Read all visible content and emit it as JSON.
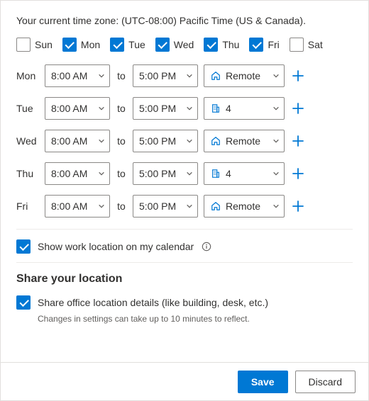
{
  "timezone_line": "Your current time zone: (UTC-08:00) Pacific Time (US & Canada).",
  "days": [
    {
      "short": "Sun",
      "checked": false
    },
    {
      "short": "Mon",
      "checked": true
    },
    {
      "short": "Tue",
      "checked": true
    },
    {
      "short": "Wed",
      "checked": true
    },
    {
      "short": "Thu",
      "checked": true
    },
    {
      "short": "Fri",
      "checked": true
    },
    {
      "short": "Sat",
      "checked": false
    }
  ],
  "to_label": "to",
  "schedule": [
    {
      "day": "Mon",
      "start": "8:00 AM",
      "end": "5:00 PM",
      "loc_type": "remote",
      "loc_label": "Remote"
    },
    {
      "day": "Tue",
      "start": "8:00 AM",
      "end": "5:00 PM",
      "loc_type": "building",
      "loc_label": "4"
    },
    {
      "day": "Wed",
      "start": "8:00 AM",
      "end": "5:00 PM",
      "loc_type": "remote",
      "loc_label": "Remote"
    },
    {
      "day": "Thu",
      "start": "8:00 AM",
      "end": "5:00 PM",
      "loc_type": "building",
      "loc_label": "4"
    },
    {
      "day": "Fri",
      "start": "8:00 AM",
      "end": "5:00 PM",
      "loc_type": "remote",
      "loc_label": "Remote"
    }
  ],
  "show_location_label": "Show work location on my calendar",
  "share_section_title": "Share your location",
  "share_details_label": "Share office location details (like building, desk, etc.)",
  "share_helper": "Changes in settings can take up to 10 minutes to reflect.",
  "buttons": {
    "save": "Save",
    "discard": "Discard"
  },
  "colors": {
    "accent": "#0078d4"
  }
}
